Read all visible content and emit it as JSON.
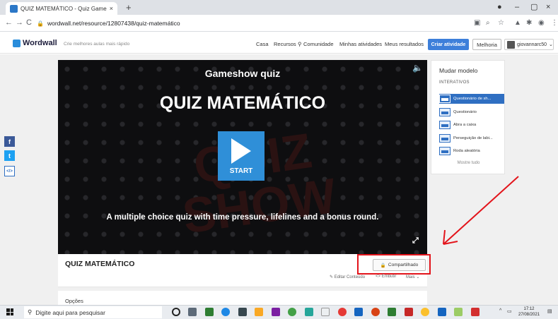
{
  "browser": {
    "tab_title": "QUIZ MATEMÁTICO - Quiz Game",
    "tab_close": "×",
    "new_tab": "+",
    "url": "wordwall.net/resource/12807438/quiz-matemático",
    "back": "←",
    "forward": "→",
    "reload": "C"
  },
  "site": {
    "logo_text": "Wordwall",
    "tagline": "Crie melhores aulas mais rápido",
    "nav": [
      "Casa",
      "Recursos",
      "Comunidade",
      "Minhas atividades",
      "Meus resultados"
    ],
    "create_button": "Criar atividade",
    "upgrade_button": "Melhoria",
    "username": "giovannarc50"
  },
  "game": {
    "label": "Gameshow quiz",
    "title": "QUIZ MATEMÁTICO",
    "start": "START",
    "description": "A multiple choice quiz with time pressure, lifelines and a bonus round.",
    "background_words": "QUIZ SHOW"
  },
  "templates": {
    "heading": "Mudar modelo",
    "section": "INTERATIVOS",
    "items": [
      {
        "label": "Questionário de sh...",
        "active": true
      },
      {
        "label": "Questionário",
        "active": false
      },
      {
        "label": "Abra a caixa",
        "active": false
      },
      {
        "label": "Perseguição de labi...",
        "active": false
      },
      {
        "label": "Roda aleatória",
        "active": false
      }
    ],
    "more": "Mostre tudo"
  },
  "activity": {
    "title": "QUIZ MATEMÁTICO",
    "share_label": "Compartilhado",
    "edit_label": "Editar Conteúdo",
    "embed_label": "Embutir",
    "more_label": "Mais",
    "options_label": "Opções"
  },
  "social": {
    "facebook": "f",
    "twitter": "t",
    "embed": "</>"
  },
  "taskbar": {
    "search_placeholder": "Digite aqui para pesquisar",
    "time": "17:12",
    "date": "27/08/2021"
  },
  "colors": {
    "accent": "#3d7fda",
    "annotation_red": "#e3141b",
    "play_blue": "#2f8fd8"
  }
}
